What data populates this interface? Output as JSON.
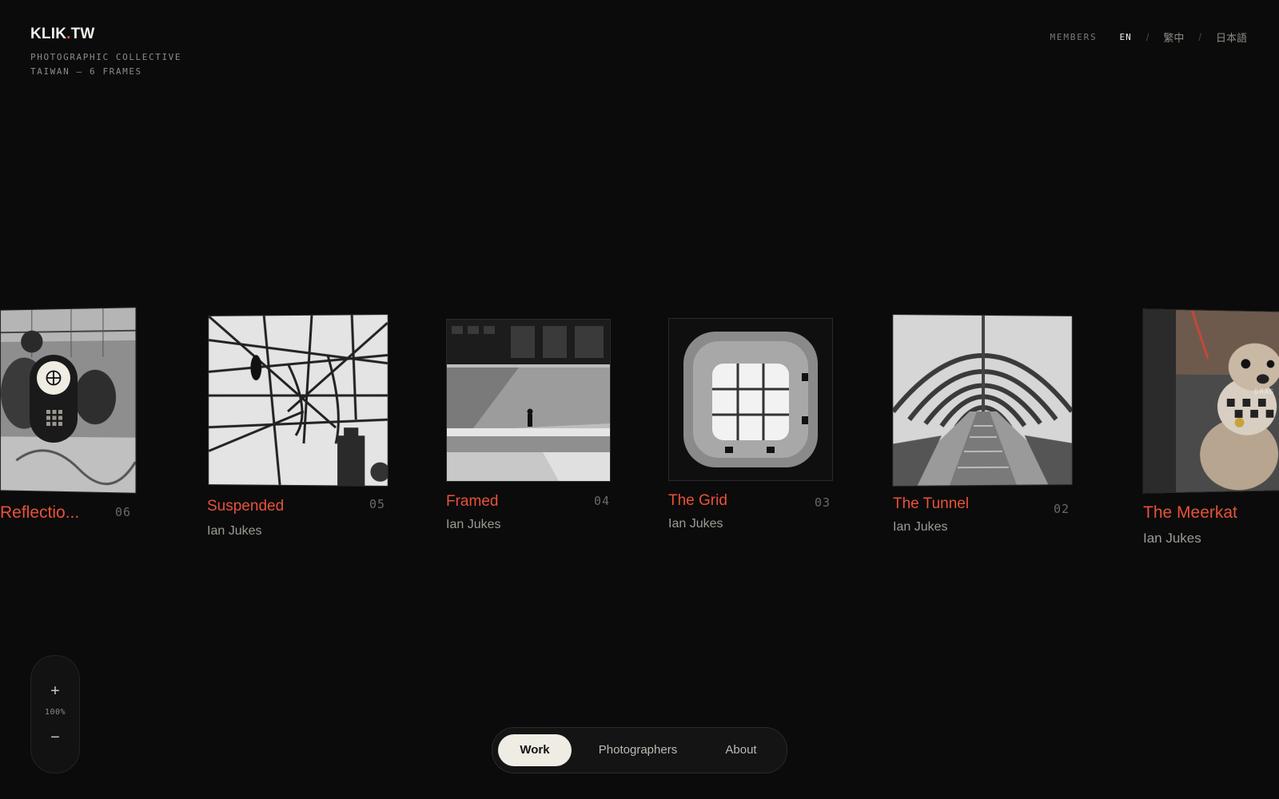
{
  "brand": {
    "logo_main": "KLIK",
    "logo_dot": ".",
    "logo_tld": "TW",
    "tagline_line1": "PHOTOGRAPHIC COLLECTIVE",
    "tagline_line2": "TAIWAN — 6 FRAMES"
  },
  "topnav": {
    "members": "MEMBERS",
    "languages": [
      "EN",
      "繁中",
      "日本語"
    ],
    "separator": "/",
    "active_language": "EN"
  },
  "works": [
    {
      "title": "Reflectio...",
      "number": "06",
      "author": ""
    },
    {
      "title": "Suspended",
      "number": "05",
      "author": "Ian Jukes"
    },
    {
      "title": "Framed",
      "number": "04",
      "author": "Ian Jukes"
    },
    {
      "title": "The Grid",
      "number": "03",
      "author": "Ian Jukes"
    },
    {
      "title": "The Tunnel",
      "number": "02",
      "author": "Ian Jukes"
    },
    {
      "title": "The Meerkat",
      "number": "",
      "author": "Ian Jukes"
    }
  ],
  "drag_hint": "DRAG",
  "view_controls": {
    "focus_icon": "crosshair-icon",
    "grid_icon": "grid-icon"
  },
  "zoom": {
    "plus": "+",
    "level": "100%",
    "minus": "−"
  },
  "bottomnav": {
    "items": [
      "Work",
      "Photographers",
      "About"
    ],
    "active": "Work"
  },
  "colors": {
    "accent": "#e8523a",
    "background": "#0b0b0b",
    "pill_active": "#efece4"
  }
}
